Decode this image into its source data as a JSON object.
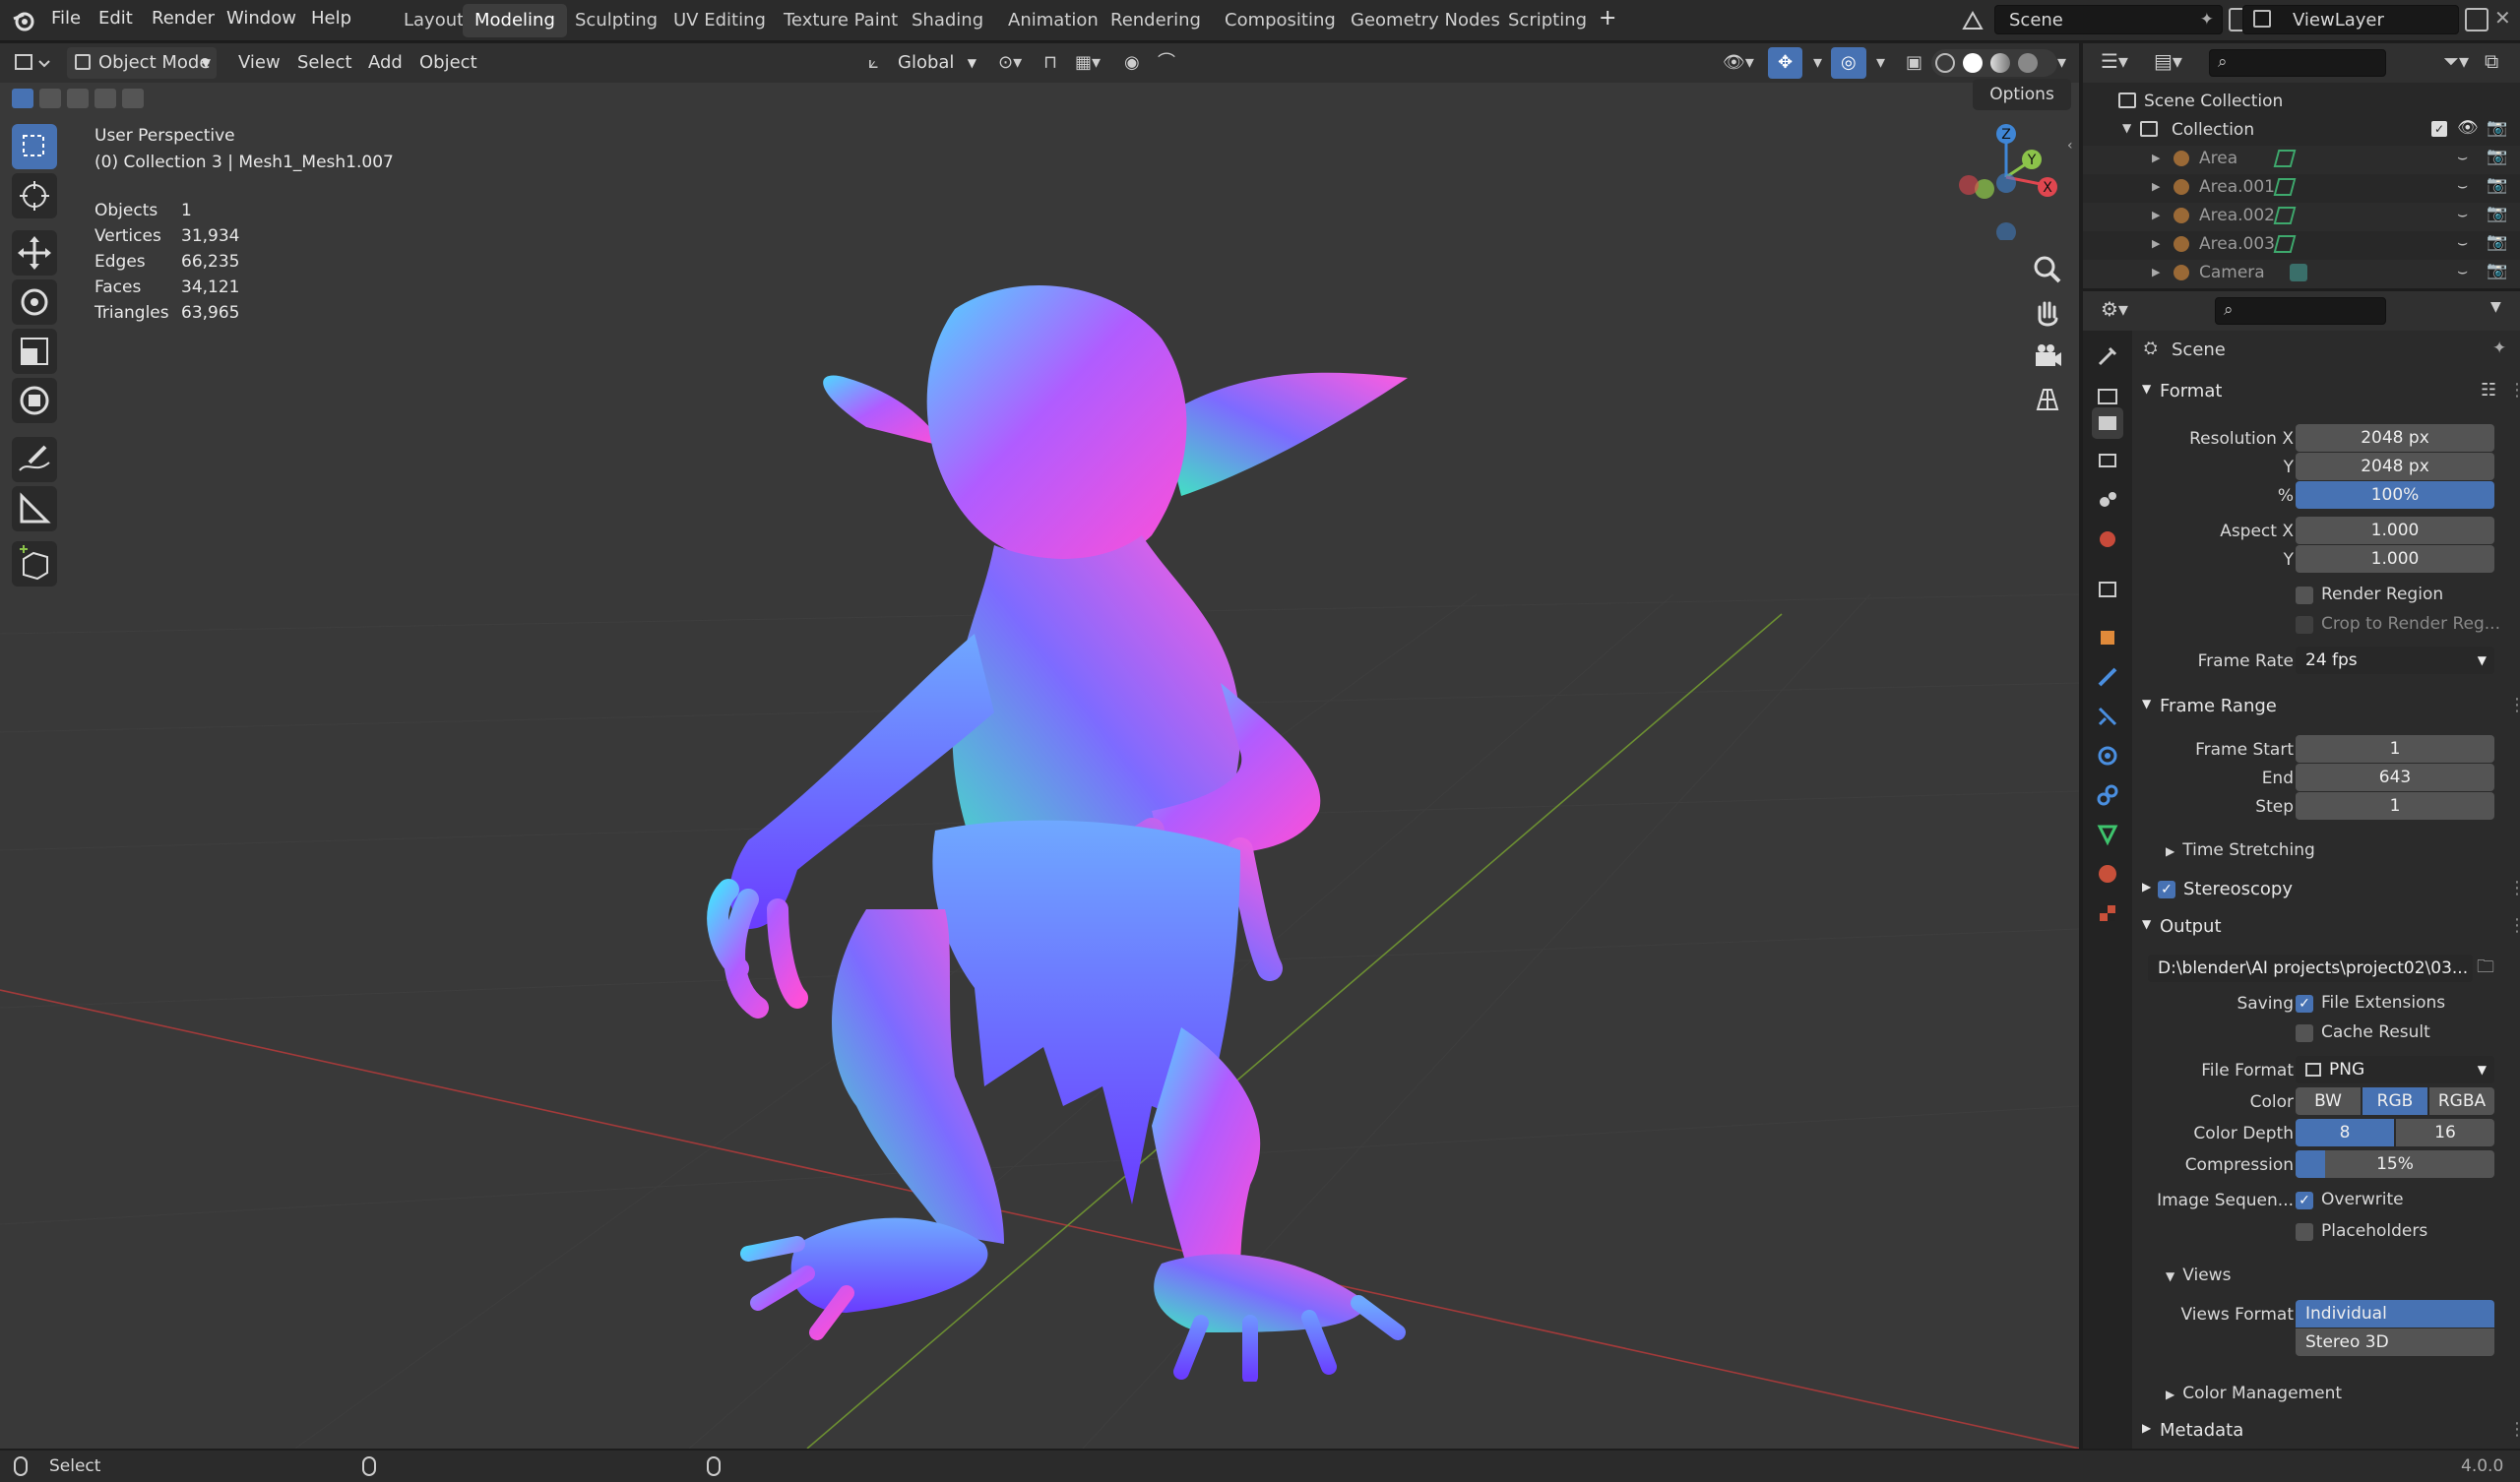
{
  "menu": {
    "file": "File",
    "edit": "Edit",
    "render": "Render",
    "window": "Window",
    "help": "Help"
  },
  "workspaces": [
    "Layout",
    "Modeling",
    "Sculpting",
    "UV Editing",
    "Texture Paint",
    "Shading",
    "Animation",
    "Rendering",
    "Compositing",
    "Geometry Nodes",
    "Scripting"
  ],
  "add_workspace": "+",
  "scene_name": "Scene",
  "view_layer": "ViewLayer",
  "viewport": {
    "mode": "Object Mode",
    "menus": {
      "view": "View",
      "select": "Select",
      "add": "Add",
      "object": "Object"
    },
    "transform_orientation": "Global",
    "options_label": "Options",
    "info": {
      "view_name": "User Perspective",
      "collection_info": "(0) Collection 3 | Mesh1_Mesh1.007",
      "stats": [
        {
          "label": "Objects",
          "value": "1"
        },
        {
          "label": "Vertices",
          "value": "31,934"
        },
        {
          "label": "Edges",
          "value": "66,235"
        },
        {
          "label": "Faces",
          "value": "34,121"
        },
        {
          "label": "Triangles",
          "value": "63,965"
        }
      ]
    },
    "gizmo": {
      "z": "Z",
      "y": "Y",
      "x": "X"
    }
  },
  "outliner": {
    "scene_collection": "Scene Collection",
    "collection": "Collection",
    "items": [
      "Area",
      "Area.001",
      "Area.002",
      "Area.003",
      "Camera"
    ]
  },
  "properties": {
    "context": "Scene",
    "format": {
      "title": "Format",
      "res_x_label": "Resolution X",
      "res_x": "2048 px",
      "res_y_label": "Y",
      "res_y": "2048 px",
      "res_pct_label": "%",
      "res_pct": "100%",
      "aspect_x_label": "Aspect X",
      "aspect_x": "1.000",
      "aspect_y_label": "Y",
      "aspect_y": "1.000",
      "render_region": "Render Region",
      "crop": "Crop to Render Reg...",
      "frame_rate_label": "Frame Rate",
      "frame_rate": "24 fps"
    },
    "frame_range": {
      "title": "Frame Range",
      "start_label": "Frame Start",
      "start": "1",
      "end_label": "End",
      "end": "643",
      "step_label": "Step",
      "step": "1",
      "time_stretching": "Time Stretching"
    },
    "stereoscopy": "Stereoscopy",
    "output": {
      "title": "Output",
      "path": "D:\\blender\\AI projects\\project02\\03...",
      "saving_label": "Saving",
      "file_extensions": "File Extensions",
      "cache_result": "Cache Result",
      "file_format_label": "File Format",
      "file_format": "PNG",
      "color_label": "Color",
      "color_options": [
        "BW",
        "RGB",
        "RGBA"
      ],
      "color_depth_label": "Color Depth",
      "color_depth_options": [
        "8",
        "16"
      ],
      "compression_label": "Compression",
      "compression": "15%",
      "compression_fraction": 0.15,
      "image_seq_label": "Image Sequen...",
      "overwrite": "Overwrite",
      "placeholders": "Placeholders"
    },
    "views": {
      "title": "Views",
      "format_label": "Views Format",
      "options": [
        "Individual",
        "Stereo 3D"
      ]
    },
    "color_management": "Color Management",
    "metadata": "Metadata"
  },
  "status": {
    "select": "Select",
    "version": "4.0.0"
  },
  "colors": {
    "accent": "#4772b3",
    "viewport_bg": "#393939",
    "panel_bg": "#2b2b2b",
    "axis_x": "#e0464f",
    "axis_y": "#8bc34a",
    "axis_z": "#3f86d6"
  }
}
